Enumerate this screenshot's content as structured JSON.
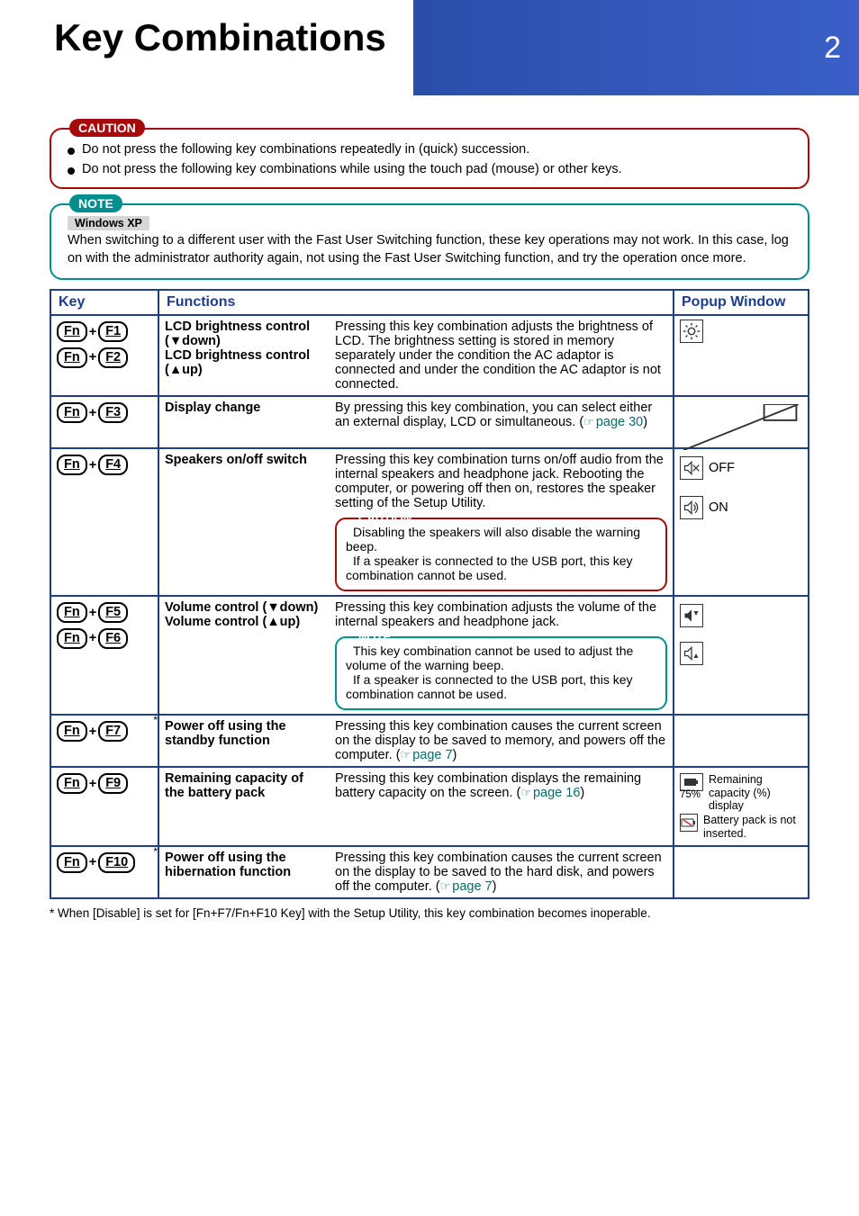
{
  "header": {
    "title": "Key Combinations",
    "page_number": "2"
  },
  "caution_box": {
    "label": "CAUTION",
    "lines": [
      "Do not press the following key combinations repeatedly in (quick) succession.",
      "Do not press the following key combinations while using the touch pad (mouse) or other keys."
    ]
  },
  "note_box": {
    "label": "NOTE",
    "os_badge": "Windows XP",
    "body": "When switching to a different user with the Fast User Switching function, these key operations may not work. In this case, log on with the administrator authority again, not using the Fast User Switching function, and try the operation once more."
  },
  "table": {
    "headers": {
      "key": "Key",
      "functions": "Functions",
      "popup": "Popup Window"
    },
    "rows": [
      {
        "keys": [
          [
            "Fn",
            "F1"
          ],
          [
            "Fn",
            "F2"
          ]
        ],
        "func_name": "LCD brightness control (▼down)\nLCD brightness control (▲up)",
        "desc": "Pressing this key combination adjusts the brightness of LCD.  The brightness setting is stored in memory separately under the condition the AC adaptor is connected and under the condition the AC adaptor is not connected.",
        "popup": {
          "type": "brightness"
        }
      },
      {
        "keys": [
          [
            "Fn",
            "F3"
          ]
        ],
        "func_name": "Display change",
        "desc": "By pressing this key combination, you can select either an external display, LCD or simultaneous. (",
        "page_ref": "page 30",
        "desc_after": ")",
        "popup": {
          "type": "display"
        }
      },
      {
        "keys": [
          [
            "Fn",
            "F4"
          ]
        ],
        "func_name": "Speakers on/off switch",
        "desc": "Pressing this key combination turns on/off audio from the internal speakers and headphone jack. Rebooting the computer, or powering off then on, restores the speaker setting of the Setup Utility.",
        "inner_caution": {
          "label": "CAUTION",
          "items": [
            "Disabling the speakers will also disable the warning beep.",
            "If a speaker is connected to the USB port, this key combination cannot be used."
          ]
        },
        "popup": {
          "type": "speaker",
          "off": "OFF",
          "on": "ON"
        }
      },
      {
        "keys": [
          [
            "Fn",
            "F5"
          ],
          [
            "Fn",
            "F6"
          ]
        ],
        "func_name": "Volume control (▼down)\nVolume control (▲up)",
        "desc": "Pressing this key combination adjusts the volume of the internal speakers and headphone jack.",
        "inner_note": {
          "label": "NOTE",
          "items": [
            "This key combination cannot be used to adjust the volume of the warning beep.",
            "If a speaker is connected to the USB port, this key combination cannot be used."
          ]
        },
        "popup": {
          "type": "volume"
        }
      },
      {
        "keys": [
          [
            "Fn",
            "F7"
          ]
        ],
        "foot": "*",
        "func_name": "Power off using the standby function",
        "desc": "Pressing this key combination causes the current screen on the display to be saved to memory, and powers off the computer. (",
        "page_ref": "page 7",
        "desc_after": ")",
        "popup": {
          "type": "empty"
        }
      },
      {
        "keys": [
          [
            "Fn",
            "F9"
          ]
        ],
        "func_name": "Remaining capacity of the battery pack",
        "desc": "Pressing this key combination displays the remaining battery capacity on the screen. (",
        "page_ref": "page 16",
        "desc_after": ")",
        "popup": {
          "type": "battery",
          "pct": "75%",
          "caption1": "Remaining capacity (%) display",
          "caption2": "Battery pack is not inserted."
        }
      },
      {
        "keys": [
          [
            "Fn",
            "F10"
          ]
        ],
        "foot": "*",
        "func_name": "Power off using the hibernation function",
        "desc": "Pressing this key combination causes the current screen on the display to be saved to the hard disk, and powers off the computer. (",
        "page_ref": "page 7",
        "desc_after": ")",
        "popup": {
          "type": "empty"
        }
      }
    ]
  },
  "footnote": "* When [Disable] is set for [Fn+F7/Fn+F10 Key] with the Setup Utility, this key combination becomes inoperable."
}
